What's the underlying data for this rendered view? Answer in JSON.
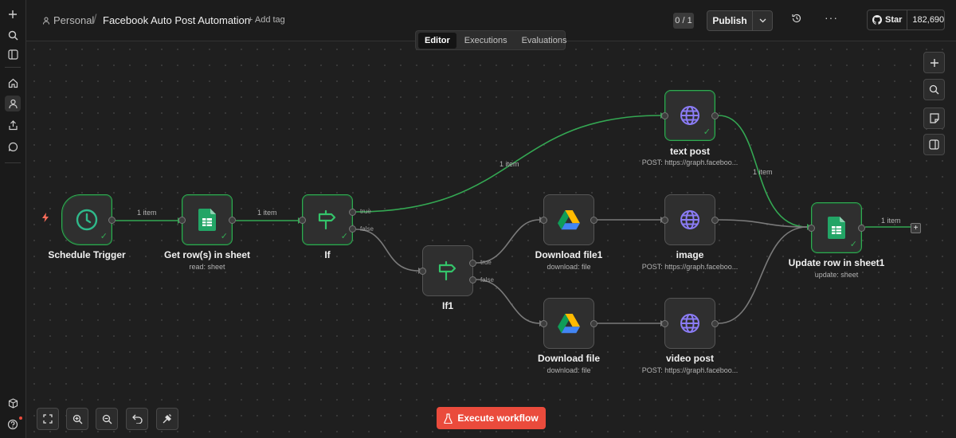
{
  "header": {
    "workspace": "Personal",
    "workflow_title": "Facebook Auto Post Automation",
    "add_tag": "+ Add tag",
    "count": "0 / 1",
    "publish": "Publish",
    "github_star": "Star",
    "github_count": "182,690"
  },
  "tabs": [
    {
      "label": "Editor",
      "active": true
    },
    {
      "label": "Executions",
      "active": false
    },
    {
      "label": "Evaluations",
      "active": false
    }
  ],
  "nodes": {
    "schedule_trigger": {
      "label": "Schedule Trigger",
      "icon": "clock-icon"
    },
    "get_rows": {
      "label": "Get row(s) in sheet",
      "sub": "read: sheet",
      "icon": "google-sheets-icon"
    },
    "if": {
      "label": "If",
      "icon": "signpost-icon",
      "true_label": "true",
      "false_label": "false"
    },
    "if1": {
      "label": "If1",
      "icon": "signpost-icon",
      "true_label": "true",
      "false_label": "false"
    },
    "text_post": {
      "label": "text post",
      "sub": "POST: https://graph.faceboo...",
      "icon": "globe-icon"
    },
    "download_file1": {
      "label": "Download file1",
      "sub": "download: file",
      "icon": "google-drive-icon"
    },
    "image": {
      "label": "image",
      "sub": "POST: https://graph.faceboo...",
      "icon": "globe-icon"
    },
    "download_file": {
      "label": "Download file",
      "sub": "download: file",
      "icon": "google-drive-icon"
    },
    "video_post": {
      "label": "video post",
      "sub": "POST: https://graph.faceboo...",
      "icon": "globe-icon"
    },
    "update_row": {
      "label": "Update row in sheet1",
      "sub": "update: sheet",
      "icon": "google-sheets-icon"
    }
  },
  "edge_labels": {
    "trigger_to_get": "1 item",
    "get_to_if": "1 item",
    "if_to_text": "1 item",
    "text_to_update": "1 item",
    "update_out": "1 item"
  },
  "execute_button": "Execute workflow",
  "colors": {
    "success": "#34a853",
    "execute": "#ea4b3c",
    "globe": "#8b7cf6",
    "canvas": "#1f1f1f"
  }
}
